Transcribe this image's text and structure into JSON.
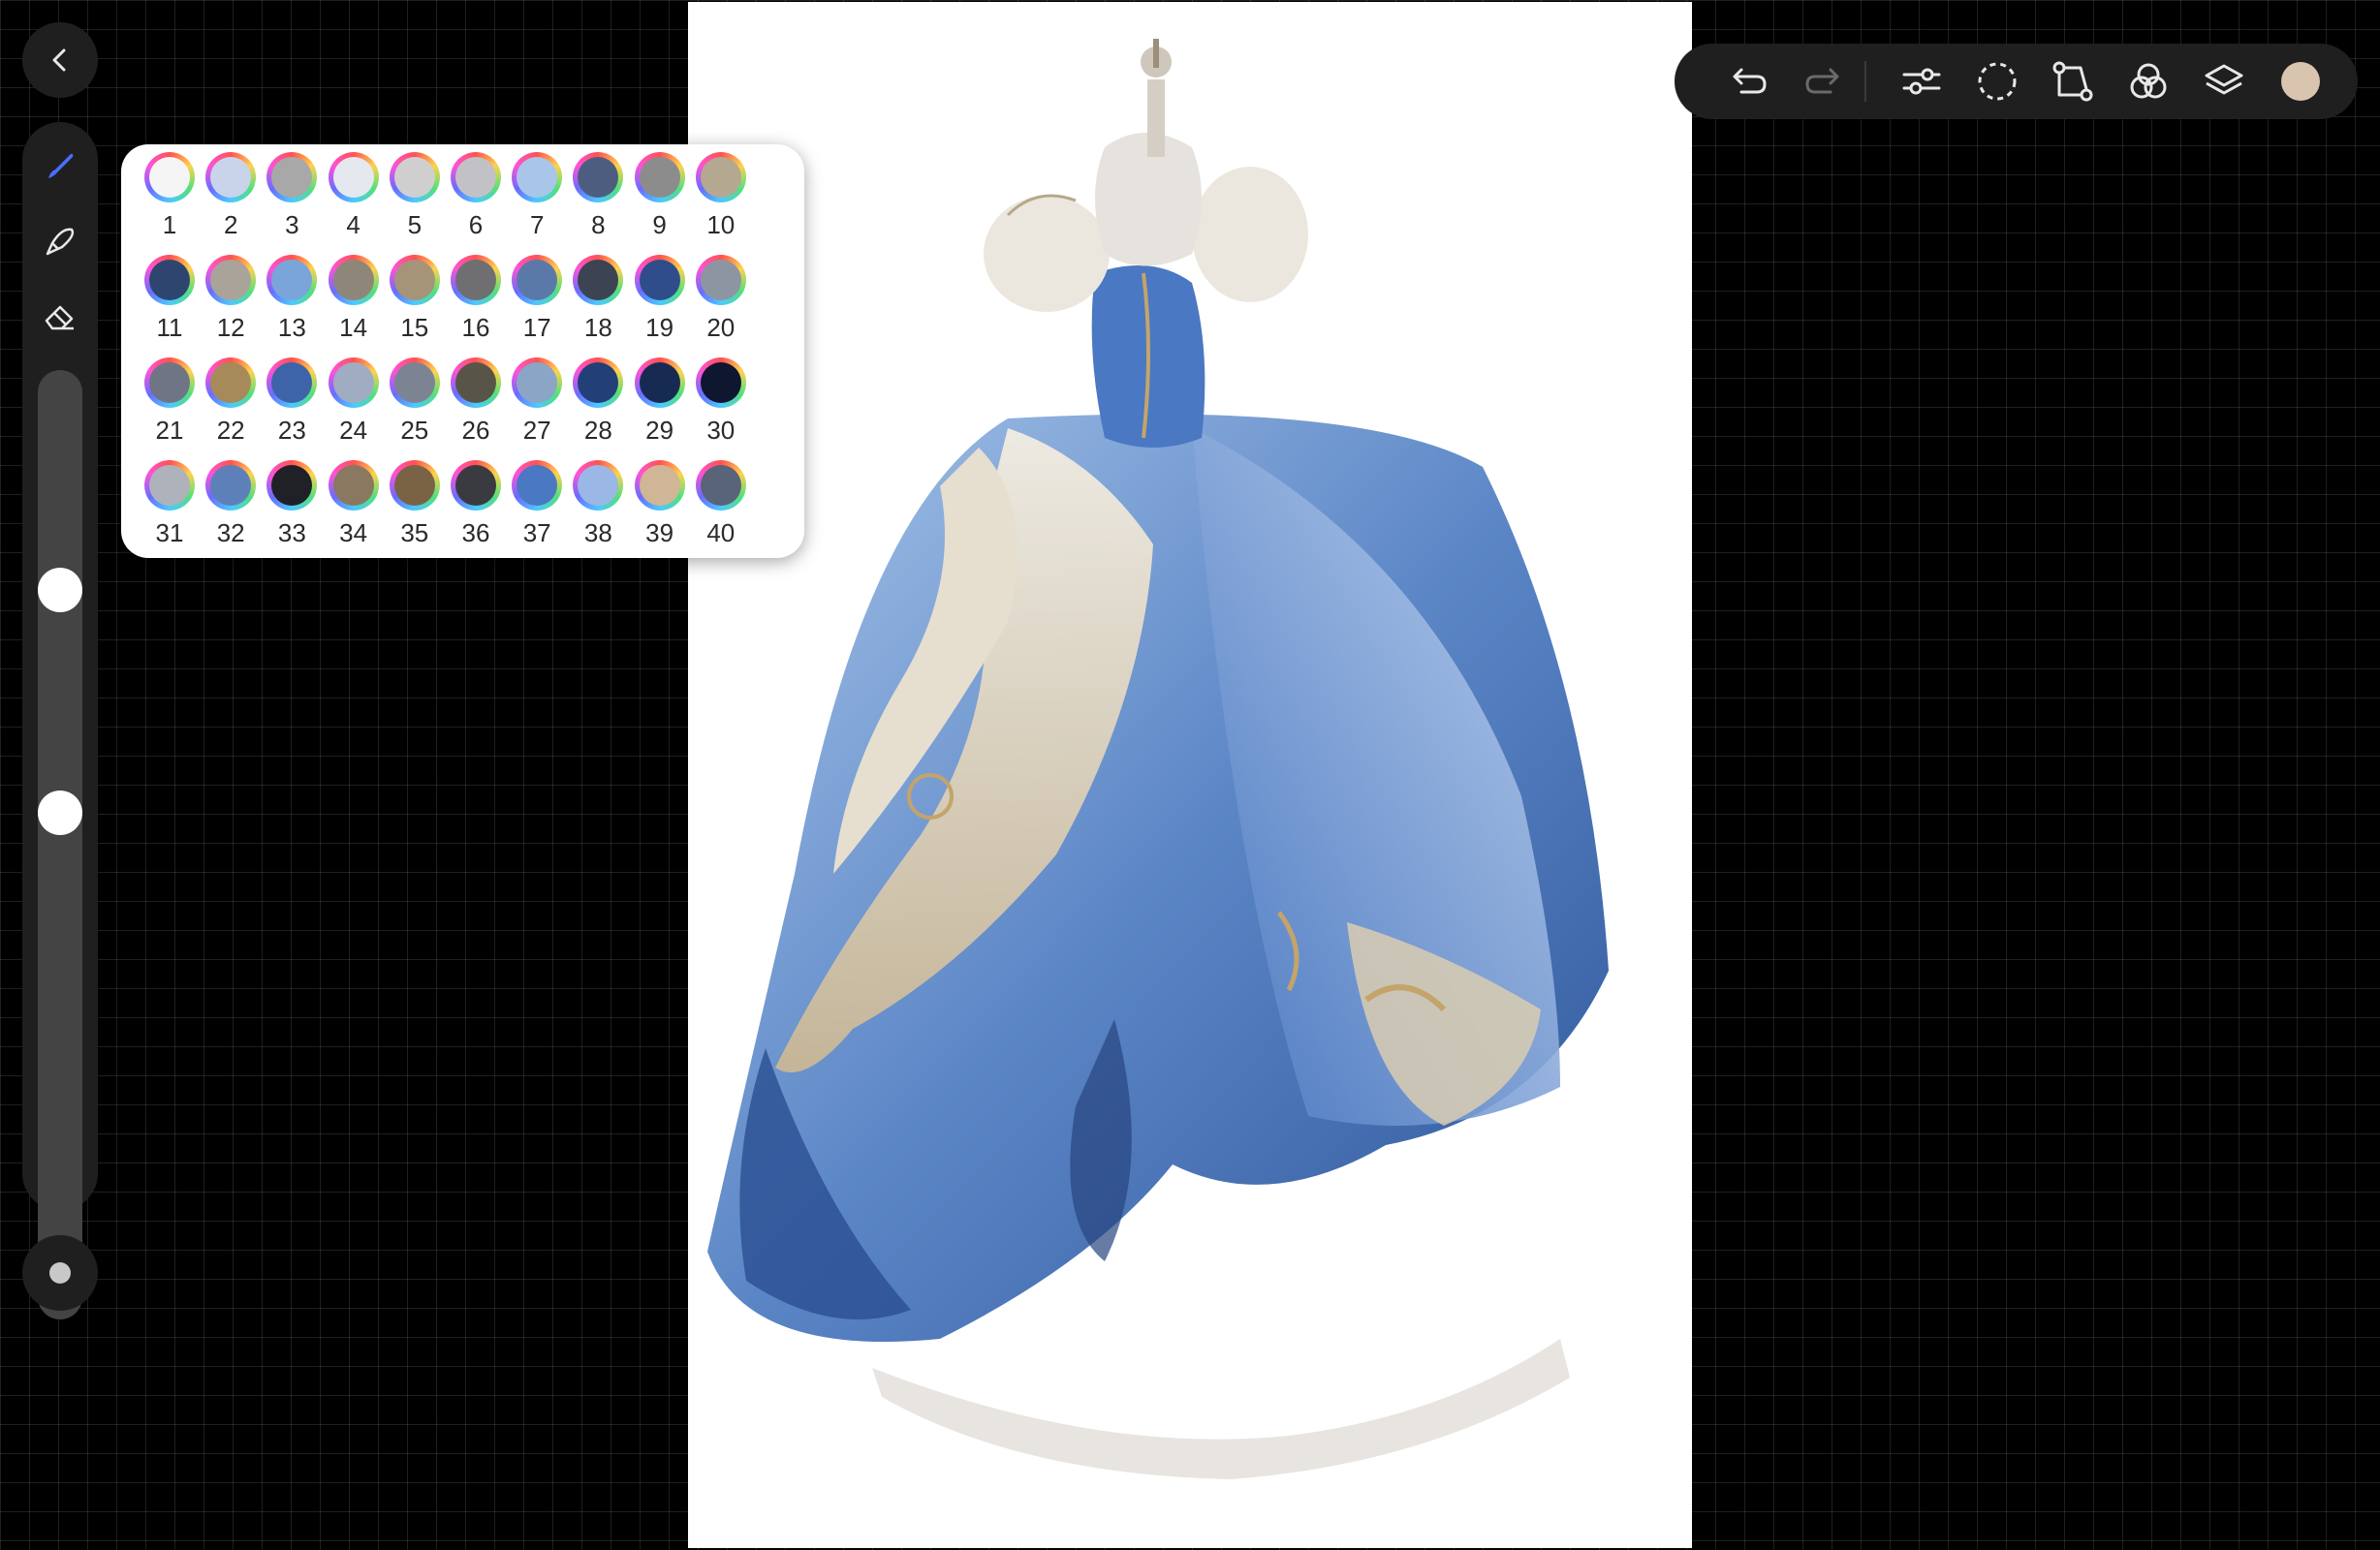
{
  "app": {
    "colors": {
      "ui_panel": "#1f1f1f",
      "accent": "#4a6dff",
      "current_color": "#d9c4b0"
    }
  },
  "sidebar": {
    "back_icon": "chevron-left-icon",
    "tools": [
      {
        "name": "brush",
        "icon": "brush-icon",
        "active": true
      },
      {
        "name": "smudge",
        "icon": "smudge-icon",
        "active": false
      },
      {
        "name": "eraser",
        "icon": "eraser-icon",
        "active": false
      }
    ],
    "brush_size": 0.44,
    "brush_opacity": 0.0,
    "modify_icon": "square-modify-icon"
  },
  "toolbar": {
    "buttons": [
      {
        "name": "undo",
        "icon": "undo-icon"
      },
      {
        "name": "redo",
        "icon": "redo-icon"
      },
      {
        "name": "adjustments",
        "icon": "adjustments-icon"
      },
      {
        "name": "selection",
        "icon": "selection-icon"
      },
      {
        "name": "transform",
        "icon": "transform-icon"
      },
      {
        "name": "colors",
        "icon": "color-circles-icon"
      },
      {
        "name": "layers",
        "icon": "layers-icon"
      }
    ]
  },
  "palette": {
    "swatches": [
      {
        "n": "1",
        "c": "#f5f5f5"
      },
      {
        "n": "2",
        "c": "#c9d4ea"
      },
      {
        "n": "3",
        "c": "#a8a8a8"
      },
      {
        "n": "4",
        "c": "#e6e8ef"
      },
      {
        "n": "5",
        "c": "#cfcfcf"
      },
      {
        "n": "6",
        "c": "#c2c2c6"
      },
      {
        "n": "7",
        "c": "#a9c6ea"
      },
      {
        "n": "8",
        "c": "#4d5d80"
      },
      {
        "n": "9",
        "c": "#8c8c8c"
      },
      {
        "n": "10",
        "c": "#b4a890"
      },
      {
        "n": "11",
        "c": "#2e4570"
      },
      {
        "n": "12",
        "c": "#a9a39a"
      },
      {
        "n": "13",
        "c": "#7aa5da"
      },
      {
        "n": "14",
        "c": "#8f867a"
      },
      {
        "n": "15",
        "c": "#a59478"
      },
      {
        "n": "16",
        "c": "#6f6f71"
      },
      {
        "n": "17",
        "c": "#5b79a8"
      },
      {
        "n": "18",
        "c": "#3c4352"
      },
      {
        "n": "19",
        "c": "#2f4d8a"
      },
      {
        "n": "20",
        "c": "#8d95a3"
      },
      {
        "n": "21",
        "c": "#6f7585"
      },
      {
        "n": "22",
        "c": "#a68a5a"
      },
      {
        "n": "23",
        "c": "#3d64a8"
      },
      {
        "n": "24",
        "c": "#a0acc2"
      },
      {
        "n": "25",
        "c": "#7c8494"
      },
      {
        "n": "26",
        "c": "#595448"
      },
      {
        "n": "27",
        "c": "#8aa5c5"
      },
      {
        "n": "28",
        "c": "#233f78"
      },
      {
        "n": "29",
        "c": "#172a52"
      },
      {
        "n": "30",
        "c": "#0f1630"
      },
      {
        "n": "31",
        "c": "#aeb2bb"
      },
      {
        "n": "32",
        "c": "#5e80b8"
      },
      {
        "n": "33",
        "c": "#1f2127"
      },
      {
        "n": "34",
        "c": "#8a7860"
      },
      {
        "n": "35",
        "c": "#7a6245"
      },
      {
        "n": "36",
        "c": "#3a3b40"
      },
      {
        "n": "37",
        "c": "#4a78c2"
      },
      {
        "n": "38",
        "c": "#9ab7e5"
      },
      {
        "n": "39",
        "c": "#d1b597"
      },
      {
        "n": "40",
        "c": "#5a6478"
      }
    ]
  }
}
